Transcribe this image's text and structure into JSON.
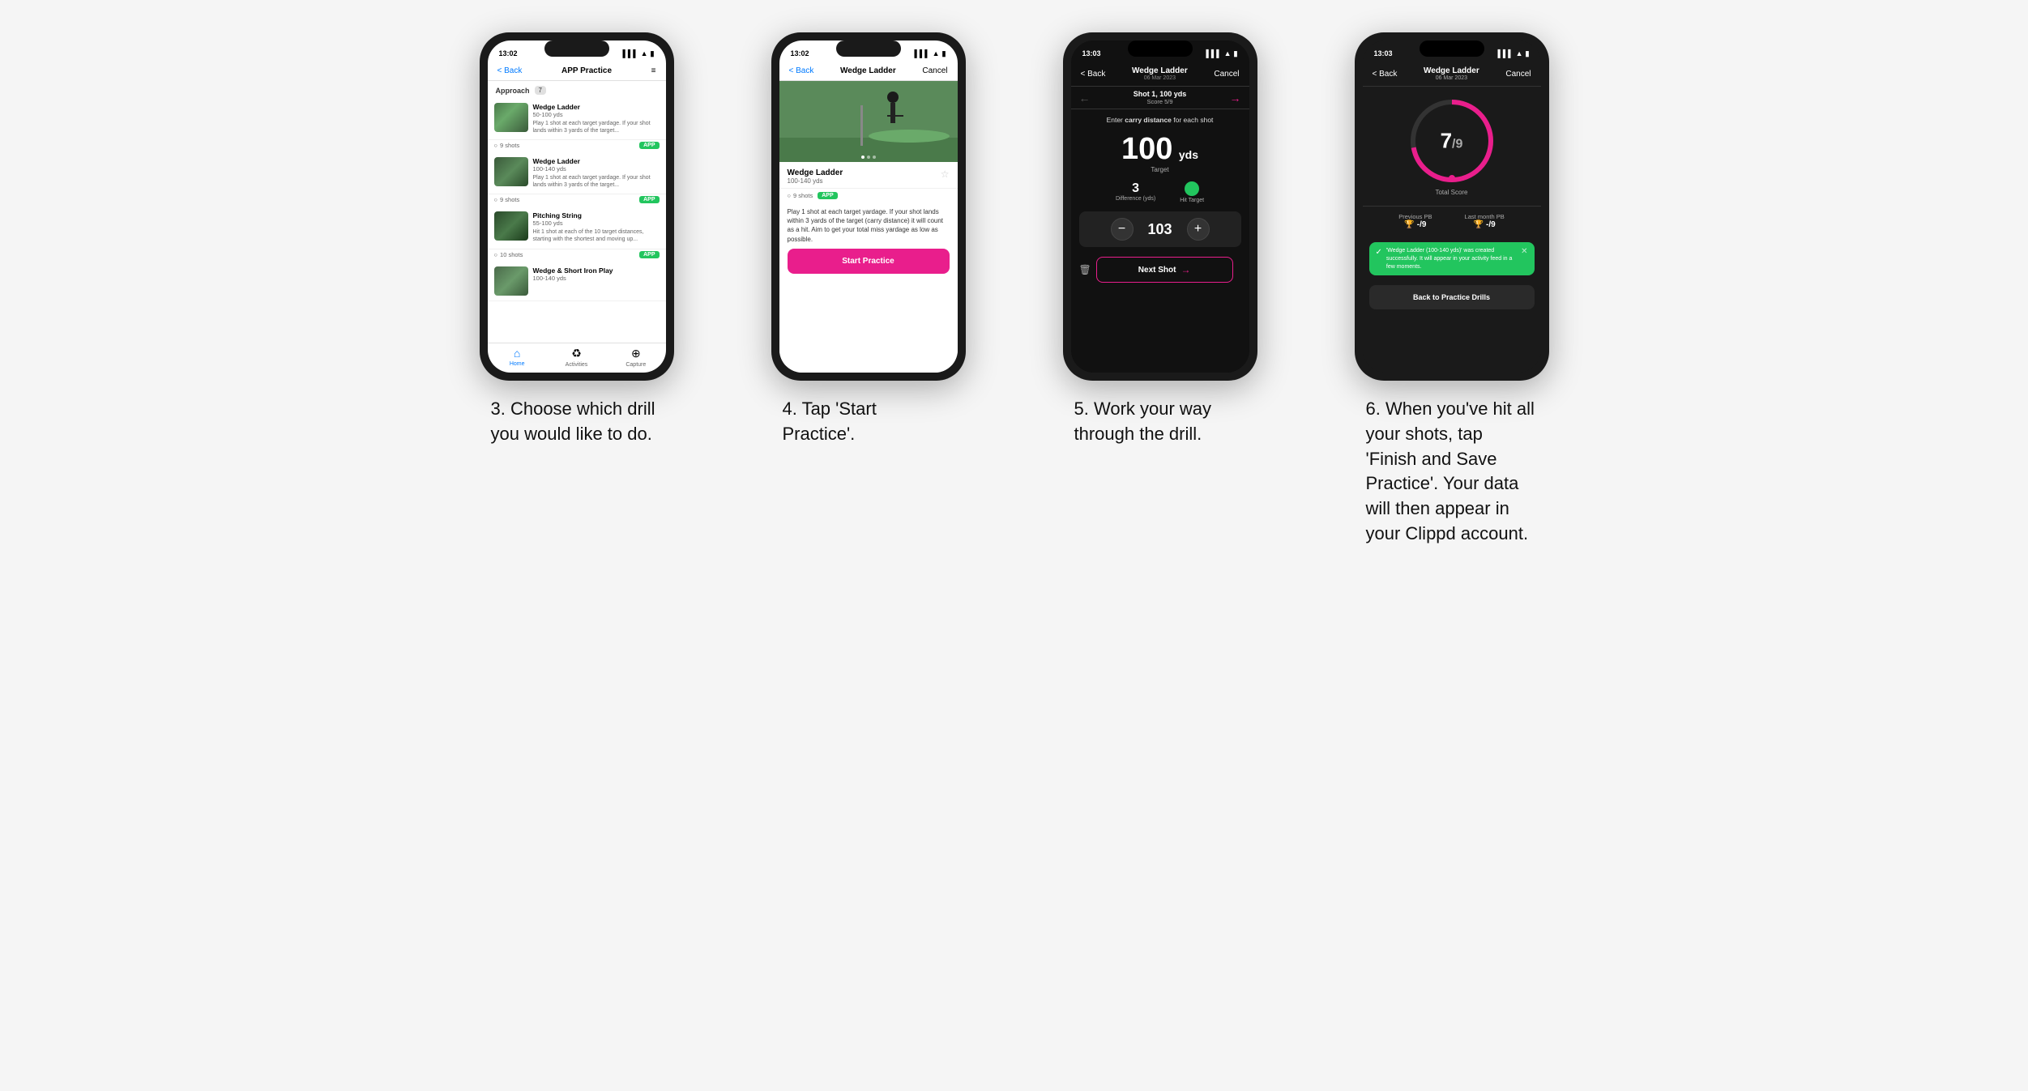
{
  "page": {
    "background": "#f5f5f5"
  },
  "phones": [
    {
      "id": "phone1",
      "status_time": "13:02",
      "nav": {
        "back": "< Back",
        "title": "APP Practice",
        "action": "≡"
      },
      "section_label": "Approach",
      "section_count": "7",
      "drills": [
        {
          "name": "Wedge Ladder",
          "yds": "50-100 yds",
          "desc": "Play 1 shot at each target yardage. If your shot lands within 3 yards of the target...",
          "shots": "9 shots",
          "badge": "APP"
        },
        {
          "name": "Wedge Ladder",
          "yds": "100-140 yds",
          "desc": "Play 1 shot at each target yardage. If your shot lands within 3 yards of the target...",
          "shots": "9 shots",
          "badge": "APP"
        },
        {
          "name": "Pitching String",
          "yds": "55-100 yds",
          "desc": "Hit 1 shot at each of the 10 target distances, starting with the shortest and moving up...",
          "shots": "10 shots",
          "badge": "APP"
        },
        {
          "name": "Wedge & Short Iron Play",
          "yds": "100-140 yds",
          "desc": "",
          "shots": "",
          "badge": ""
        }
      ],
      "bottom_nav": [
        {
          "label": "Home",
          "icon": "⌂",
          "active": true
        },
        {
          "label": "Activities",
          "icon": "♻",
          "active": false
        },
        {
          "label": "Capture",
          "icon": "⊕",
          "active": false
        }
      ],
      "caption": "3. Choose which drill you would like to do."
    },
    {
      "id": "phone2",
      "status_time": "13:02",
      "nav": {
        "back": "< Back",
        "title": "Wedge Ladder",
        "action": "Cancel"
      },
      "drill": {
        "name": "Wedge Ladder",
        "yds": "100-140 yds",
        "shots": "9 shots",
        "badge": "APP",
        "desc": "Play 1 shot at each target yardage. If your shot lands within 3 yards of the target (carry distance) it will count as a hit. Aim to get your total miss yardage as low as possible."
      },
      "start_btn": "Start Practice",
      "caption": "4. Tap 'Start Practice'."
    },
    {
      "id": "phone3",
      "status_time": "13:03",
      "nav": {
        "back": "< Back",
        "title_line1": "Wedge Ladder",
        "title_line2": "06 Mar 2023",
        "action": "Cancel"
      },
      "shot_nav": {
        "shot_title": "Shot 1, 100 yds",
        "shot_subtitle": "Score 5/9"
      },
      "carry_prompt": "Enter carry distance for each shot",
      "target_yds": "100",
      "target_unit": "yds",
      "target_label": "Target",
      "difference": "3",
      "difference_label": "Difference (yds)",
      "hit_target_label": "Hit Target",
      "input_value": "103",
      "next_shot": "Next Shot",
      "caption": "5. Work your way through the drill."
    },
    {
      "id": "phone4",
      "status_time": "13:03",
      "nav": {
        "back": "< Back",
        "title_line1": "Wedge Ladder",
        "title_line2": "06 Mar 2023",
        "action": "Cancel"
      },
      "score": "7",
      "score_total": "9",
      "total_score_label": "Total Score",
      "previous_pb_label": "Previous PB",
      "previous_pb_value": "-/9",
      "last_month_pb_label": "Last month PB",
      "last_month_pb_value": "-/9",
      "toast_text": "'Wedge Ladder (100-140 yds)' was created successfully. It will appear in your activity feed in a few moments.",
      "back_btn": "Back to Practice Drills",
      "caption": "6. When you've hit all your shots, tap 'Finish and Save Practice'. Your data will then appear in your Clippd account."
    }
  ]
}
